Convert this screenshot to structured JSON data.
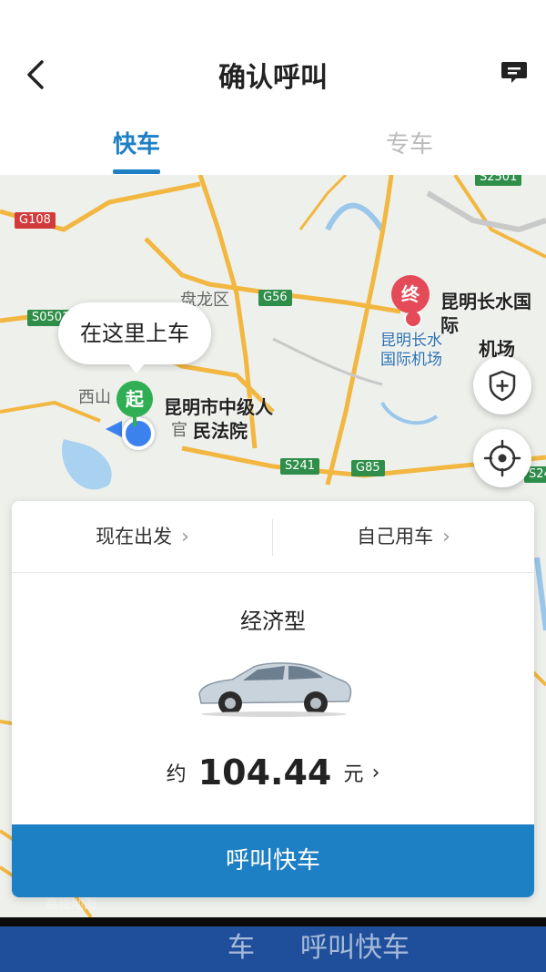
{
  "header": {
    "title": "确认呼叫",
    "back_icon": "chevron-left-icon",
    "message_icon": "message-icon"
  },
  "tabs": [
    {
      "label": "快车",
      "active": true
    },
    {
      "label": "专车",
      "active": false
    }
  ],
  "map": {
    "road_badges": [
      "G108",
      "G56",
      "S0501",
      "S241",
      "G85",
      "S2501",
      "S24"
    ],
    "places": [
      "盘龙区",
      "西山",
      "官"
    ],
    "pickup_bubble": "在这里上车",
    "start_pin": "起",
    "end_pin": "终",
    "start_poi": [
      "昆明市中级人",
      "民法院"
    ],
    "end_poi": [
      "昆明长水国际",
      "机场"
    ],
    "end_poi_blue": [
      "昆明长水",
      "国际机场"
    ],
    "safety_icon": "shield-plus-icon",
    "locate_icon": "crosshair-icon",
    "watermark": "高德地图"
  },
  "options": {
    "depart": "现在出发",
    "rider": "自己用车"
  },
  "car": {
    "type": "经济型",
    "price_prefix": "约",
    "price": "104.44",
    "price_unit": "元",
    "call_button": "呼叫快车"
  },
  "bottom_ghost": [
    "呼叫快车",
    "车"
  ],
  "colors": {
    "accent": "#1d7fc4",
    "start": "#2fae54",
    "end": "#e44a58"
  }
}
